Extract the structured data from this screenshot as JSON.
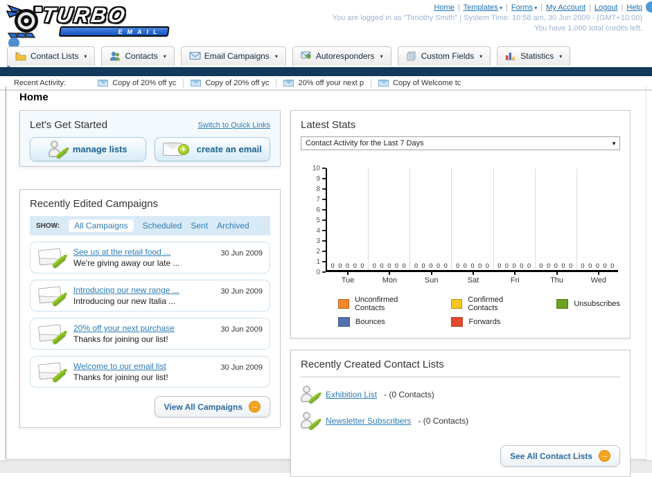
{
  "header": {
    "logo_line1": "TURBO",
    "logo_line2": "EMAIL",
    "nav": [
      {
        "label": "Home",
        "dropdown": false
      },
      {
        "label": "Templates",
        "dropdown": true
      },
      {
        "label": "Forms",
        "dropdown": true
      },
      {
        "label": "My Account",
        "dropdown": false
      },
      {
        "label": "Logout",
        "dropdown": false
      },
      {
        "label": "Help",
        "dropdown": false
      }
    ],
    "status_line1": "You are logged in as \"Timothy Smith\" | System Time: 10:58 am, 30 Jun 2009 - (GMT+10:00)",
    "status_line2": "You have 1,000 total credits left."
  },
  "tabs": [
    {
      "label": "Contact Lists",
      "icon": "contact-lists-icon"
    },
    {
      "label": "Contacts",
      "icon": "contacts-icon"
    },
    {
      "label": "Email Campaigns",
      "icon": "email-campaigns-icon"
    },
    {
      "label": "Autoresponders",
      "icon": "autoresponders-icon"
    },
    {
      "label": "Custom Fields",
      "icon": "custom-fields-icon"
    },
    {
      "label": "Statistics",
      "icon": "statistics-icon"
    }
  ],
  "recent_activity": {
    "label": "Recent Activity:",
    "items": [
      "Copy of 20% off yc",
      "Copy of 20% off yc",
      "20% off your next p",
      "Copy of Welcome tc"
    ]
  },
  "page_title": "Home",
  "get_started": {
    "title": "Let's Get Started",
    "switch_link": "Switch to Quick Links",
    "manage_lists_label": "manage lists",
    "create_email_label": "create an email"
  },
  "campaigns": {
    "title": "Recently Edited Campaigns",
    "show_label": "SHOW:",
    "filters": [
      "All Campaigns",
      "Scheduled",
      "Sent",
      "Archived"
    ],
    "active_filter": "All Campaigns",
    "items": [
      {
        "title": "See us at the retail food ...",
        "subtitle": "We're giving away our late ...",
        "date": "30 Jun 2009"
      },
      {
        "title": "Introducing our new range ...",
        "subtitle": "Introducing our new Italia ...",
        "date": "30 Jun 2009"
      },
      {
        "title": "20% off your next purchase",
        "subtitle": "Thanks for joining our list!",
        "date": "30 Jun 2009"
      },
      {
        "title": "Welcome to our email list",
        "subtitle": "Thanks for joining our list!",
        "date": "30 Jun 2009"
      }
    ],
    "view_all_label": "View All Campaigns"
  },
  "latest_stats": {
    "title": "Latest Stats",
    "dropdown_value": "Contact Activity for the Last 7 Days"
  },
  "chart_data": {
    "type": "bar",
    "title": "Contact Activity for the Last 7 Days",
    "categories": [
      "Tue",
      "Mon",
      "Sun",
      "Sat",
      "Fri",
      "Thu",
      "Wed"
    ],
    "series": [
      {
        "name": "Unconfirmed Contacts",
        "color": "#f2882b",
        "values": [
          0,
          0,
          0,
          0,
          0,
          0,
          0
        ]
      },
      {
        "name": "Confirmed Contacts",
        "color": "#f6c51f",
        "values": [
          0,
          0,
          0,
          0,
          0,
          0,
          0
        ]
      },
      {
        "name": "Unsubscribes",
        "color": "#6ca21f",
        "values": [
          0,
          0,
          0,
          0,
          0,
          0,
          0
        ]
      },
      {
        "name": "Bounces",
        "color": "#5471ad",
        "values": [
          0,
          0,
          0,
          0,
          0,
          0,
          0
        ]
      },
      {
        "name": "Forwards",
        "color": "#e44a2d",
        "values": [
          0,
          0,
          0,
          0,
          0,
          0,
          0
        ]
      }
    ],
    "xlabel": "",
    "ylabel": "",
    "ylim": [
      0,
      10
    ],
    "ytick_step": 1,
    "grid": "vertical",
    "legend_position": "bottom",
    "value_labels_shown": true
  },
  "contact_lists": {
    "title": "Recently Created Contact Lists",
    "items": [
      {
        "name": "Exhibition List",
        "count_text": "- (0 Contacts)"
      },
      {
        "name": "Newsletter Subscribers",
        "count_text": "- (0 Contacts)"
      }
    ],
    "see_all_label": "See All Contact Lists"
  },
  "colors": {
    "navy_bar": "#12395b",
    "link_blue": "#1c6fad",
    "status_text": "#9db4d2",
    "go_circle_orange": "#f5a522",
    "show_bar_bg": "#d9eaf7"
  }
}
